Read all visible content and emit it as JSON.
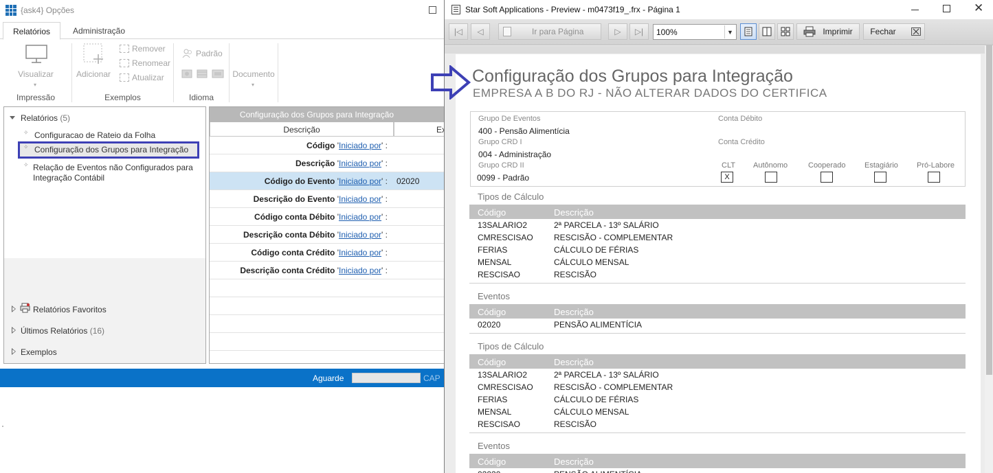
{
  "left_window": {
    "title": "{ask4}  Opções",
    "tabs": [
      "Relatórios",
      "Administração"
    ],
    "ribbon": {
      "impressao": {
        "button": "Visualizar",
        "group": "Impressão"
      },
      "exemplos": {
        "add": "Adicionar",
        "remove": "Remover",
        "rename": "Renomear",
        "update": "Atualizar",
        "group": "Exemplos"
      },
      "idioma": {
        "padrao": "Padrão",
        "group": "Idioma"
      },
      "documento": {
        "button": "Documento"
      }
    },
    "tree": {
      "root_label": "Relatórios",
      "root_count": "(5)",
      "items": [
        "Configuracao de Rateio da Folha",
        "Configuração dos Grupos para Integração",
        "Relação de Eventos não Configurados para",
        "Integração Contábil"
      ],
      "favoritos": "Relatórios Favoritos",
      "ultimos": "Últimos Relatórios",
      "ultimos_count": "(16)",
      "exemplos": "Exemplos"
    },
    "grid": {
      "header": "Configuração dos Grupos para Integração",
      "col_descricao": "Descrição",
      "col_ex": "Ex",
      "link_text": "Iniciado por",
      "rows": [
        {
          "label": "Código",
          "value": ""
        },
        {
          "label": "Descrição",
          "value": ""
        },
        {
          "label": "Código do Evento",
          "value": "02020"
        },
        {
          "label": "Descrição do Evento",
          "value": ""
        },
        {
          "label": "Código conta Débito",
          "value": ""
        },
        {
          "label": "Descrição conta Débito",
          "value": ""
        },
        {
          "label": "Código conta Crédito",
          "value": ""
        },
        {
          "label": "Descrição conta Crédito",
          "value": ""
        }
      ]
    },
    "status": {
      "label": "Aguarde",
      "cap": "CAP"
    }
  },
  "preview_window": {
    "title": "Star Soft Applications - Preview - m0473f19_.frx - Página 1",
    "toolbar": {
      "goto_page": "Ir para Página",
      "zoom": "100%",
      "print": "Imprimir",
      "close": "Fechar"
    },
    "report": {
      "title": "Configuração dos Grupos para Integração",
      "subtitle": "EMPRESA A B DO RJ - NÃO ALTERAR DADOS DO CERTIFICA",
      "info": {
        "grupo_eventos_label": "Grupo De Eventos",
        "grupo_eventos_value": "400 - Pensão Alimentícia",
        "grupo_crd1_label": "Grupo CRD I",
        "grupo_crd1_value": "004 - Administração",
        "grupo_crd2_label": "Grupo CRD II",
        "grupo_crd2_value": "0099 - Padrão",
        "conta_debito_label": "Conta Débito",
        "conta_credito_label": "Conta Crédito",
        "checkboxes": [
          {
            "label": "CLT",
            "checked": "X"
          },
          {
            "label": "Autônomo",
            "checked": ""
          },
          {
            "label": "Cooperado",
            "checked": ""
          },
          {
            "label": "Estagiário",
            "checked": ""
          },
          {
            "label": "Pró-Labore",
            "checked": ""
          }
        ]
      },
      "col_codigo": "Código",
      "col_descricao": "Descrição",
      "tipos_title": "Tipos de Cálculo",
      "eventos_title": "Eventos",
      "tipos_rows": [
        {
          "codigo": "13SALARIO2",
          "descricao": "2ª PARCELA - 13º SALÁRIO"
        },
        {
          "codigo": "CMRESCISAO",
          "descricao": "RESCISÃO - COMPLEMENTAR"
        },
        {
          "codigo": "FERIAS",
          "descricao": "CÁLCULO DE FÉRIAS"
        },
        {
          "codigo": "MENSAL",
          "descricao": "CÁLCULO MENSAL"
        },
        {
          "codigo": "RESCISAO",
          "descricao": "RESCISÃO"
        }
      ],
      "eventos_rows": [
        {
          "codigo": "02020",
          "descricao": "PENSÃO ALIMENTÍCIA"
        }
      ]
    }
  },
  "colors": {
    "accent_blue": "#0a72c8",
    "highlight_border": "#3d40b5",
    "arrow": "#3d40b5"
  }
}
